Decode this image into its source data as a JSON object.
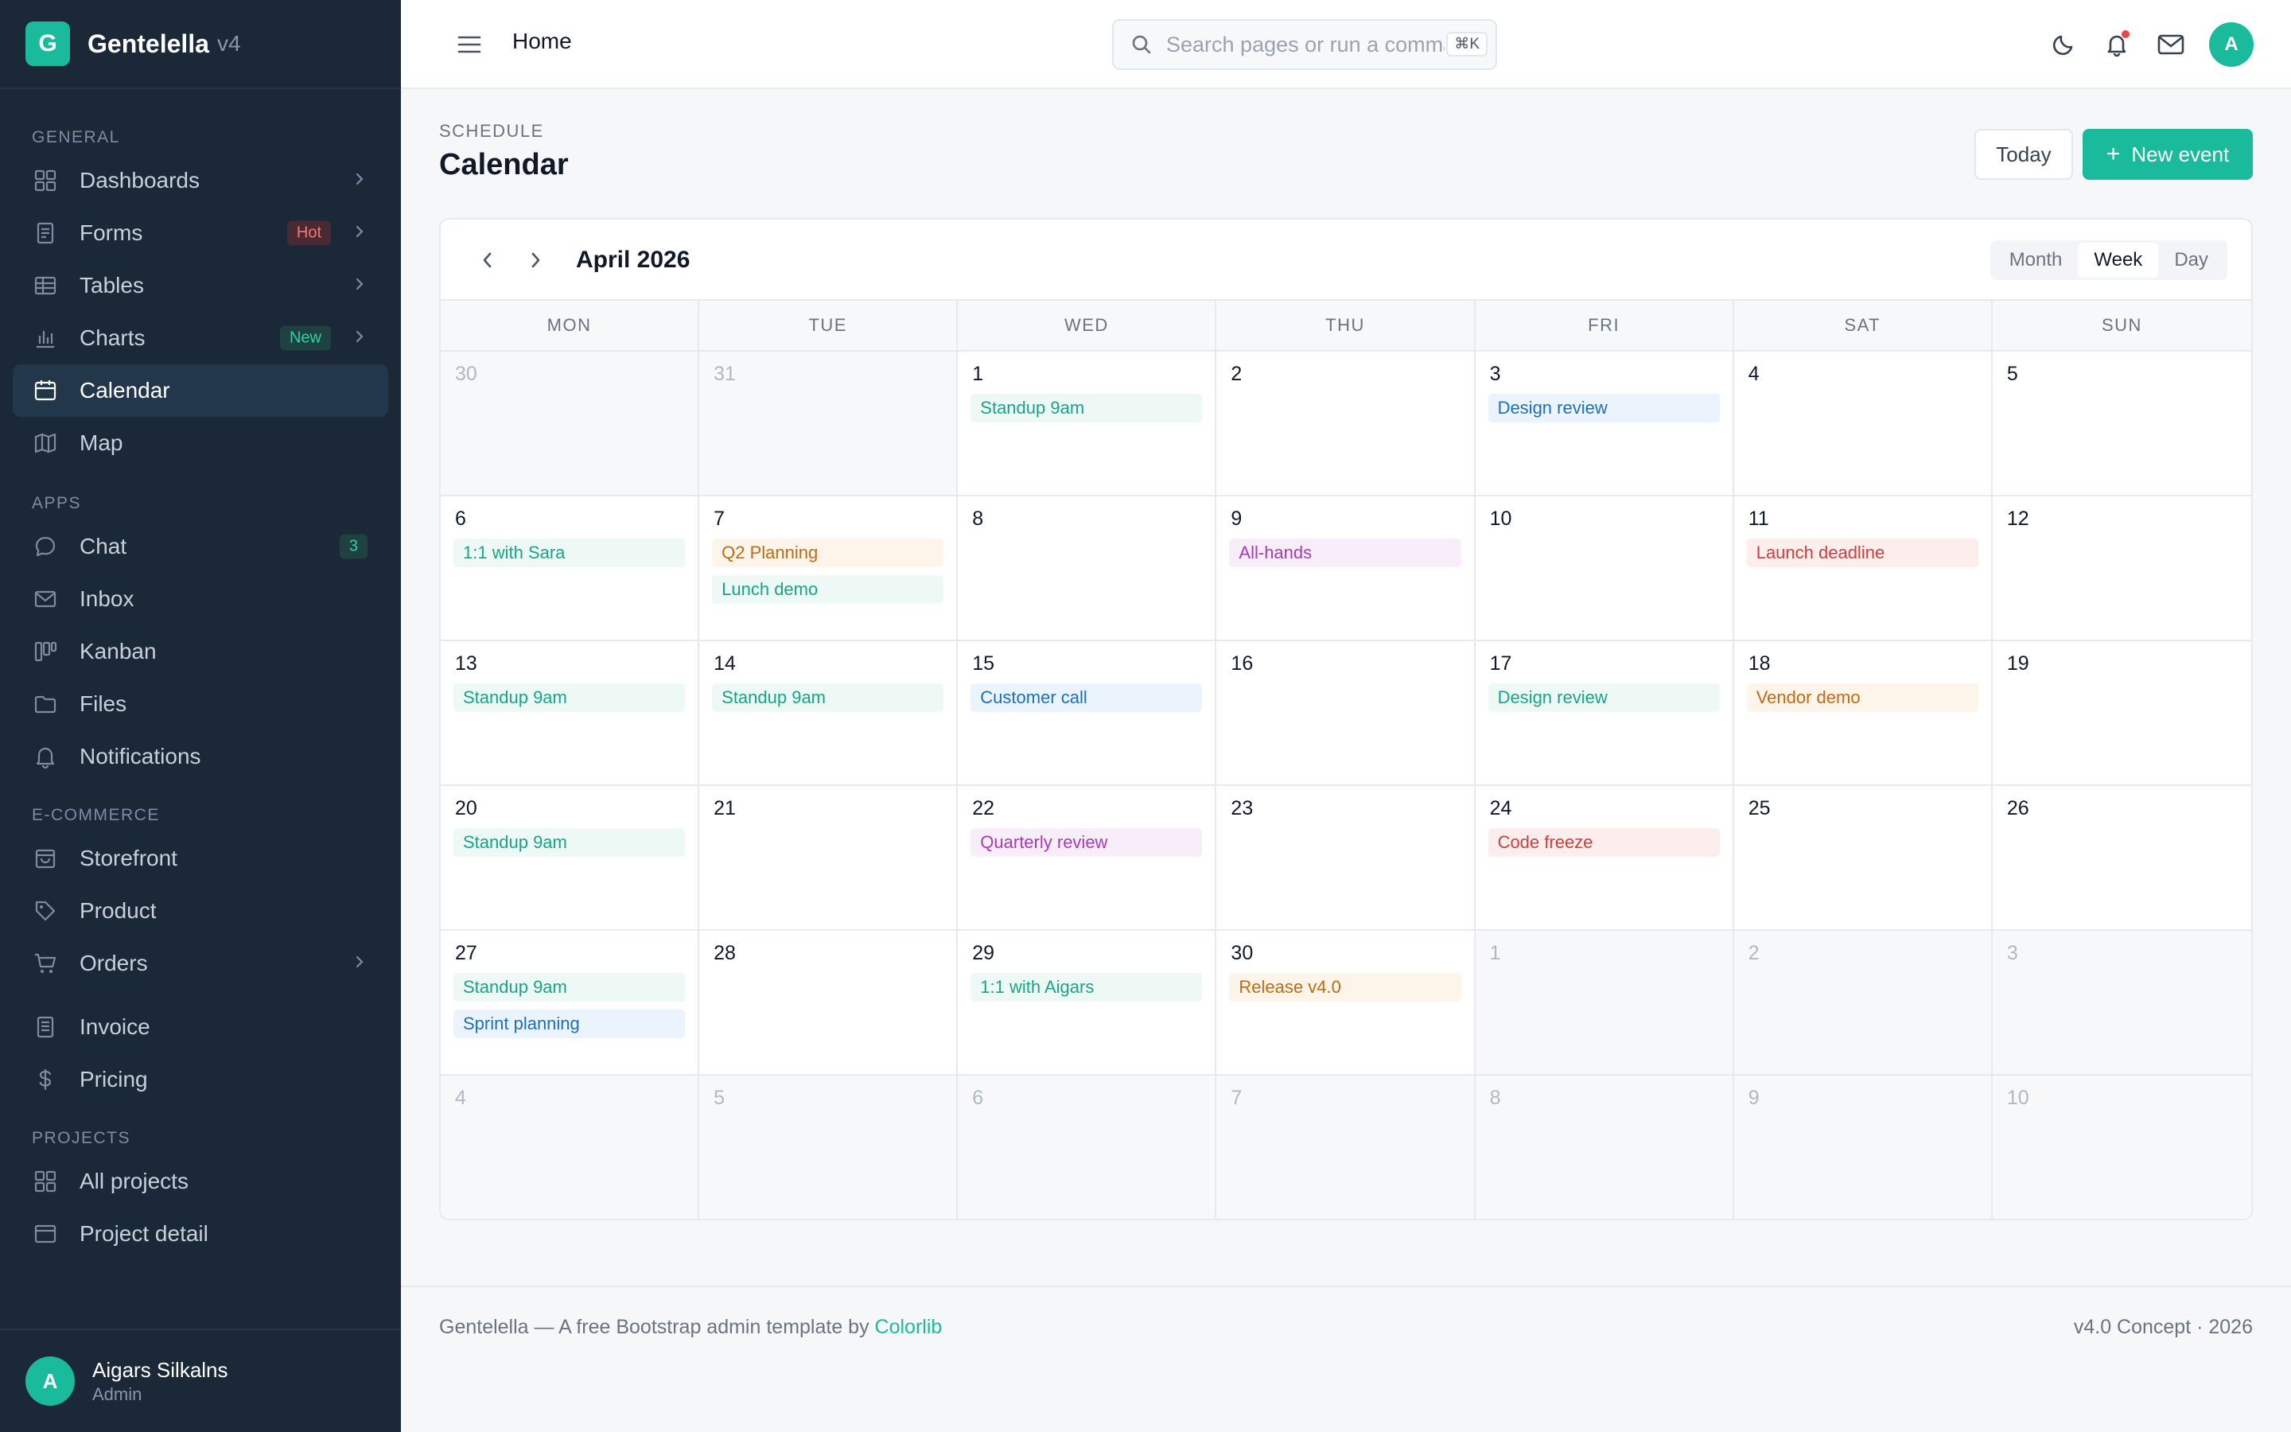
{
  "brand": {
    "logo_letter": "G",
    "name": "Gentelella",
    "version": "v4"
  },
  "sidebar": {
    "sections": [
      {
        "title": "GENERAL",
        "items": [
          {
            "label": "Dashboards",
            "icon": "grid-icon",
            "chevron": true
          },
          {
            "label": "Forms",
            "icon": "form-icon",
            "chevron": true,
            "badge": "Hot",
            "badge_type": "hot"
          },
          {
            "label": "Tables",
            "icon": "table-icon",
            "chevron": true
          },
          {
            "label": "Charts",
            "icon": "bar-chart-icon",
            "chevron": true,
            "badge": "New",
            "badge_type": "new"
          },
          {
            "label": "Calendar",
            "icon": "calendar-icon",
            "active": true
          },
          {
            "label": "Map",
            "icon": "map-icon"
          }
        ]
      },
      {
        "title": "APPS",
        "items": [
          {
            "label": "Chat",
            "icon": "chat-icon",
            "badge": "3",
            "badge_type": "count"
          },
          {
            "label": "Inbox",
            "icon": "mail-icon"
          },
          {
            "label": "Kanban",
            "icon": "kanban-icon"
          },
          {
            "label": "Files",
            "icon": "folder-icon"
          },
          {
            "label": "Notifications",
            "icon": "bell-icon"
          }
        ]
      },
      {
        "title": "E-COMMERCE",
        "items": [
          {
            "label": "Storefront",
            "icon": "store-icon"
          },
          {
            "label": "Product",
            "icon": "tag-icon"
          },
          {
            "label": "Orders",
            "icon": "cart-icon",
            "chevron": true
          },
          {
            "label": "Invoice",
            "icon": "invoice-icon"
          },
          {
            "label": "Pricing",
            "icon": "dollar-icon"
          }
        ]
      },
      {
        "title": "PROJECTS",
        "items": [
          {
            "label": "All projects",
            "icon": "grid-icon"
          },
          {
            "label": "Project detail",
            "icon": "window-icon"
          }
        ]
      }
    ],
    "user": {
      "initial": "A",
      "name": "Aigars Silkalns",
      "role": "Admin"
    }
  },
  "topbar": {
    "breadcrumb": "Home",
    "search_placeholder": "Search pages or run a command",
    "search_shortcut": "⌘K",
    "avatar_initial": "A"
  },
  "page": {
    "pretitle": "SCHEDULE",
    "title": "Calendar",
    "today_label": "Today",
    "new_event_label": "New event"
  },
  "calendar": {
    "month_title": "April 2026",
    "views": [
      "Month",
      "Week",
      "Day"
    ],
    "selected_view": "Week",
    "weekdays": [
      "MON",
      "TUE",
      "WED",
      "THU",
      "FRI",
      "SAT",
      "SUN"
    ],
    "days": [
      {
        "n": "30",
        "muted": true,
        "events": []
      },
      {
        "n": "31",
        "muted": true,
        "events": []
      },
      {
        "n": "1",
        "events": [
          {
            "t": "Standup 9am",
            "c": "green"
          }
        ]
      },
      {
        "n": "2",
        "events": []
      },
      {
        "n": "3",
        "events": [
          {
            "t": "Design review",
            "c": "blue"
          }
        ]
      },
      {
        "n": "4",
        "events": []
      },
      {
        "n": "5",
        "events": []
      },
      {
        "n": "6",
        "events": [
          {
            "t": "1:1 with Sara",
            "c": "green"
          }
        ]
      },
      {
        "n": "7",
        "events": [
          {
            "t": "Q2 Planning",
            "c": "orange"
          },
          {
            "t": "Lunch demo",
            "c": "green"
          }
        ]
      },
      {
        "n": "8",
        "events": []
      },
      {
        "n": "9",
        "events": [
          {
            "t": "All-hands",
            "c": "purple"
          }
        ]
      },
      {
        "n": "10",
        "events": []
      },
      {
        "n": "11",
        "events": [
          {
            "t": "Launch deadline",
            "c": "red"
          }
        ]
      },
      {
        "n": "12",
        "events": []
      },
      {
        "n": "13",
        "events": [
          {
            "t": "Standup 9am",
            "c": "green"
          }
        ]
      },
      {
        "n": "14",
        "events": [
          {
            "t": "Standup 9am",
            "c": "green"
          }
        ]
      },
      {
        "n": "15",
        "events": [
          {
            "t": "Customer call",
            "c": "blue"
          }
        ]
      },
      {
        "n": "16",
        "events": []
      },
      {
        "n": "17",
        "events": [
          {
            "t": "Design review",
            "c": "green"
          }
        ]
      },
      {
        "n": "18",
        "events": [
          {
            "t": "Vendor demo",
            "c": "orange"
          }
        ]
      },
      {
        "n": "19",
        "events": []
      },
      {
        "n": "20",
        "events": [
          {
            "t": "Standup 9am",
            "c": "green"
          }
        ]
      },
      {
        "n": "21",
        "events": []
      },
      {
        "n": "22",
        "events": [
          {
            "t": "Quarterly review",
            "c": "purple"
          }
        ]
      },
      {
        "n": "23",
        "events": []
      },
      {
        "n": "24",
        "events": [
          {
            "t": "Code freeze",
            "c": "red"
          }
        ]
      },
      {
        "n": "25",
        "events": []
      },
      {
        "n": "26",
        "events": []
      },
      {
        "n": "27",
        "events": [
          {
            "t": "Standup 9am",
            "c": "green"
          },
          {
            "t": "Sprint planning",
            "c": "blue"
          }
        ]
      },
      {
        "n": "28",
        "events": []
      },
      {
        "n": "29",
        "events": [
          {
            "t": "1:1 with Aigars",
            "c": "green"
          }
        ]
      },
      {
        "n": "30",
        "events": [
          {
            "t": "Release v4.0",
            "c": "orange"
          }
        ]
      },
      {
        "n": "1",
        "muted": true,
        "events": []
      },
      {
        "n": "2",
        "muted": true,
        "events": []
      },
      {
        "n": "3",
        "muted": true,
        "events": []
      },
      {
        "n": "4",
        "muted": true,
        "events": []
      },
      {
        "n": "5",
        "muted": true,
        "events": []
      },
      {
        "n": "6",
        "muted": true,
        "events": []
      },
      {
        "n": "7",
        "muted": true,
        "events": []
      },
      {
        "n": "8",
        "muted": true,
        "events": []
      },
      {
        "n": "9",
        "muted": true,
        "events": []
      },
      {
        "n": "10",
        "muted": true,
        "events": []
      }
    ]
  },
  "footer": {
    "left_text": "Gentelella — A free Bootstrap admin template by ",
    "left_link": "Colorlib",
    "right_text": "v4.0 Concept · 2026"
  }
}
